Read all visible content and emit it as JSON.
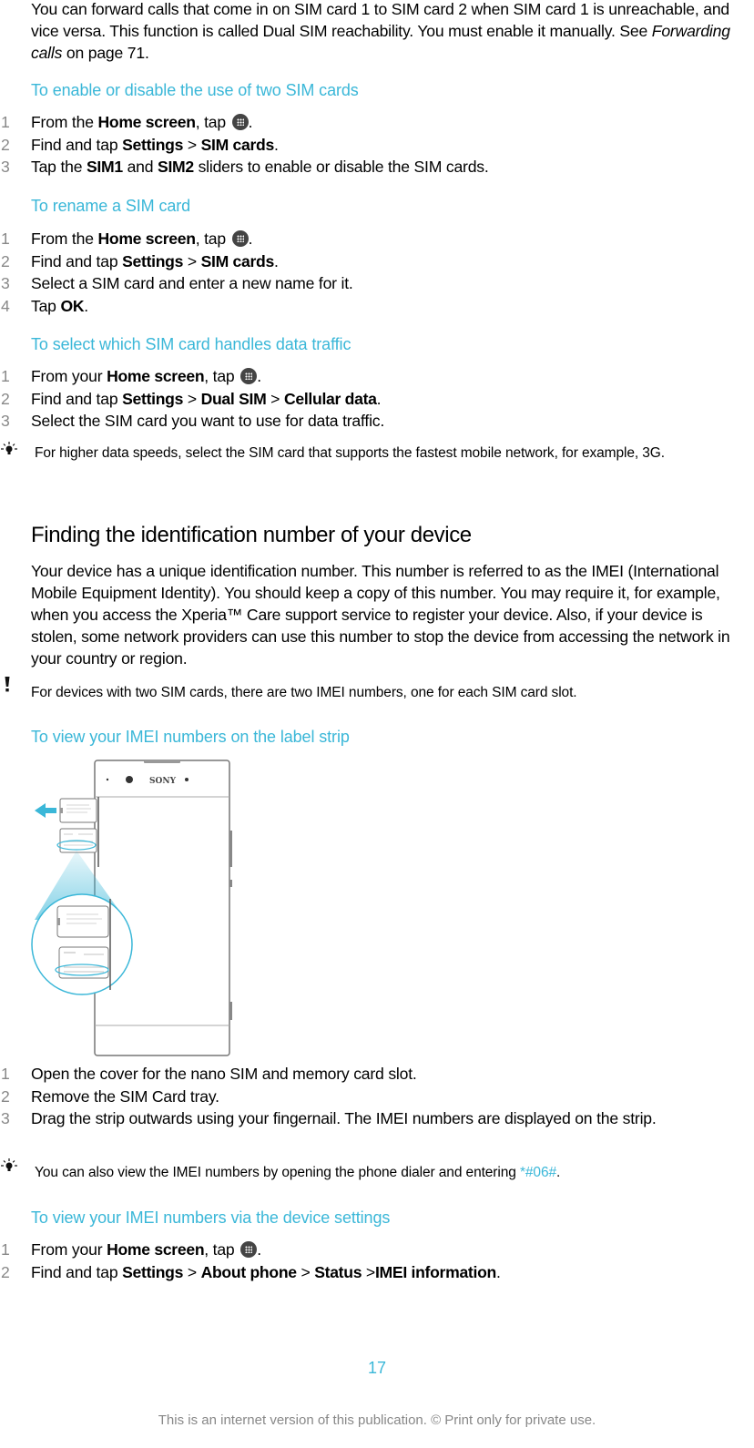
{
  "intro": {
    "text_before_link": "You can forward calls that come in on SIM card 1 to SIM card 2 when SIM card 1 is unreachable, and vice versa. This function is called Dual SIM reachability. You must enable it manually. See ",
    "link": "Forwarding calls",
    "text_after_link": " on page 71."
  },
  "sections": [
    {
      "title": "To enable or disable the use of two SIM cards",
      "steps": [
        {
          "num": "1",
          "parts": [
            "From the ",
            "Home screen",
            ", tap ",
            "",
            "."
          ]
        },
        {
          "num": "2",
          "parts": [
            "Find and tap ",
            "Settings",
            " > ",
            "SIM cards",
            "."
          ]
        },
        {
          "num": "3",
          "parts": [
            "Tap the ",
            "SIM1",
            " and ",
            "SIM2",
            " sliders to enable or disable the SIM cards."
          ]
        }
      ]
    },
    {
      "title": "To rename a SIM card",
      "steps": [
        {
          "num": "1",
          "parts": [
            "From the ",
            "Home screen",
            ", tap ",
            "",
            "."
          ]
        },
        {
          "num": "2",
          "parts": [
            "Find and tap ",
            "Settings",
            " > ",
            "SIM cards",
            "."
          ]
        },
        {
          "num": "3",
          "parts": [
            "Select a SIM card and enter a new name for it."
          ]
        },
        {
          "num": "4",
          "parts": [
            "Tap ",
            "OK",
            "."
          ]
        }
      ]
    },
    {
      "title": "To select which SIM card handles data traffic",
      "steps": [
        {
          "num": "1",
          "parts": [
            "From your ",
            "Home screen",
            ", tap ",
            "",
            "."
          ]
        },
        {
          "num": "2",
          "parts": [
            "Find and tap ",
            "Settings",
            " > ",
            "Dual SIM",
            " > ",
            "Cellular data",
            "."
          ]
        },
        {
          "num": "3",
          "parts": [
            "Select the SIM card you want to use for data traffic."
          ]
        }
      ],
      "tip": "For higher data speeds, select the SIM card that supports the fastest mobile network, for example, 3G."
    }
  ],
  "imei": {
    "heading": "Finding the identification number of your device",
    "body": "Your device has a unique identification number. This number is referred to as the IMEI (International Mobile Equipment Identity). You should keep a copy of this number. You may require it, for example, when you access the Xperia™ Care support service to register your device. Also, if your device is stolen, some network providers can use this number to stop the device from accessing the network in your country or region.",
    "warning": "For devices with two SIM cards, there are two IMEI numbers, one for each SIM card slot.",
    "label_strip": {
      "title": "To view your IMEI numbers on the label strip",
      "figure_brand": "SONY",
      "steps": [
        {
          "num": "1",
          "text": "Open the cover for the nano SIM and memory card slot."
        },
        {
          "num": "2",
          "text": "Remove the SIM Card tray."
        },
        {
          "num": "3",
          "text": "Drag the strip outwards using your fingernail. The IMEI numbers are displayed on the strip."
        }
      ],
      "tip_before": "You can also view the IMEI numbers by opening the phone dialer and entering ",
      "tip_code": "*#06#",
      "tip_after": "."
    },
    "settings": {
      "title": "To view your IMEI numbers via the device settings",
      "steps": [
        {
          "num": "1",
          "parts": [
            "From your ",
            "Home screen",
            ", tap ",
            "",
            "."
          ]
        },
        {
          "num": "2",
          "parts": [
            "Find and tap ",
            "Settings",
            " > ",
            "About phone",
            " > ",
            "Status",
            " >",
            "IMEI information",
            "."
          ]
        }
      ]
    }
  },
  "footer": {
    "page_number": "17",
    "notice": "This is an internet version of this publication. © Print only for private use."
  },
  "colors": {
    "accent": "#3ab7d8",
    "step_number": "#888888",
    "icon": "#444444"
  }
}
